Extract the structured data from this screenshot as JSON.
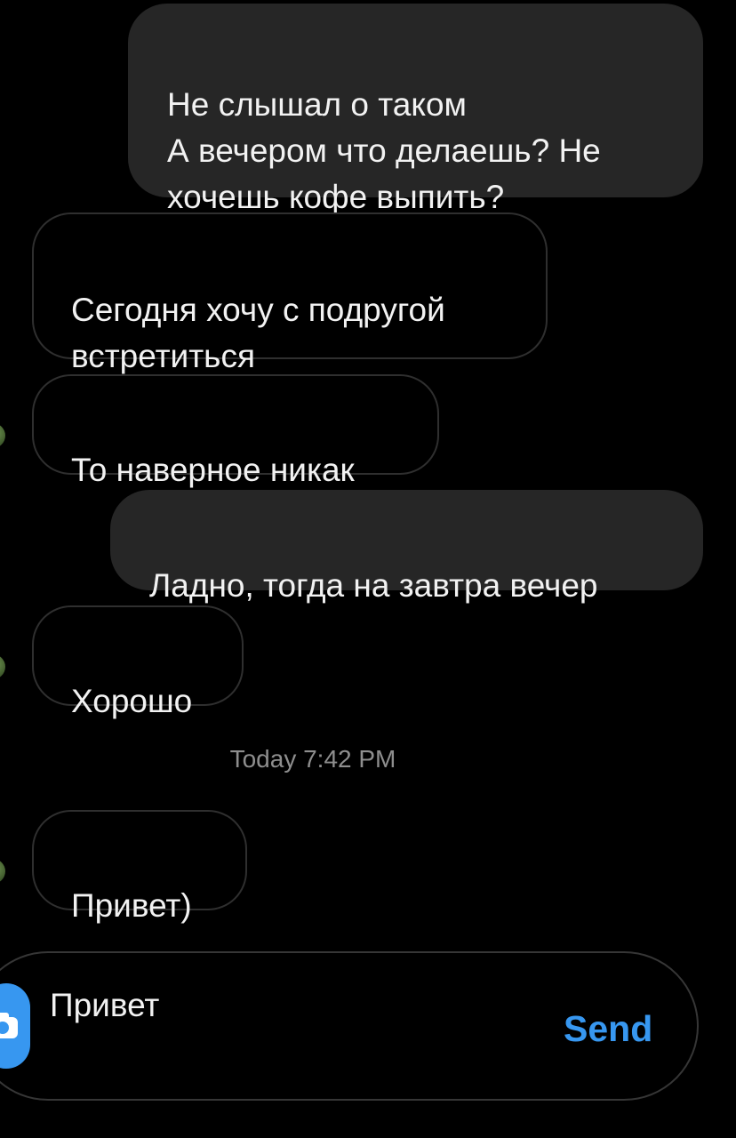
{
  "messages": [
    {
      "direction": "sent",
      "text": "Не слышал о таком\nА вечером что делаешь? Не хочешь кофе выпить?"
    },
    {
      "direction": "received",
      "text": "Сегодня хочу с подругой встретиться"
    },
    {
      "direction": "received",
      "text": "То наверное никак"
    },
    {
      "direction": "sent",
      "text": "Ладно, тогда на завтра вечер"
    },
    {
      "direction": "received",
      "text": "Хорошо"
    },
    {
      "direction": "received",
      "text": "Привет)"
    }
  ],
  "timestamp": "Today 7:42 PM",
  "composer": {
    "value": "Привет",
    "send_label": "Send",
    "camera_icon": "camera-icon"
  },
  "colors": {
    "background": "#000000",
    "sent_bubble": "#262626",
    "received_border": "#2f2f2f",
    "accent": "#3797f0",
    "timestamp": "#8e8e8e"
  }
}
